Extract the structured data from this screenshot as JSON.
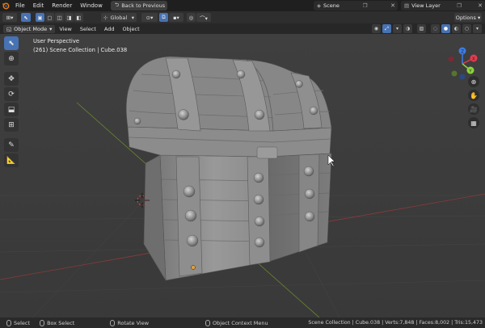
{
  "app": {
    "menu": [
      "File",
      "Edit",
      "Render",
      "Window",
      "Help"
    ],
    "back_button": "Back to Previous",
    "scene": "Scene",
    "view_layer": "View Layer"
  },
  "tool_header": {
    "orientation": "Global",
    "options": "Options"
  },
  "viewport_header": {
    "mode": "Object Mode",
    "menus": [
      "View",
      "Select",
      "Add",
      "Object"
    ]
  },
  "viewport": {
    "perspective": "User Perspective",
    "collection": "(261) Scene Collection | Cube.038"
  },
  "gizmo": {
    "axes": [
      "X",
      "Y",
      "Z"
    ],
    "colors": {
      "x": "#e8394d",
      "y": "#8bd43b",
      "z": "#3d7ce4"
    }
  },
  "statusbar": {
    "select": "Select",
    "box_select": "Box Select",
    "rotate_view": "Rotate View",
    "context_menu": "Object Context Menu",
    "stats": "Scene Collection | Cube.038 | Verts:7,848 | Faces:8,002 | Tris:15,473"
  }
}
